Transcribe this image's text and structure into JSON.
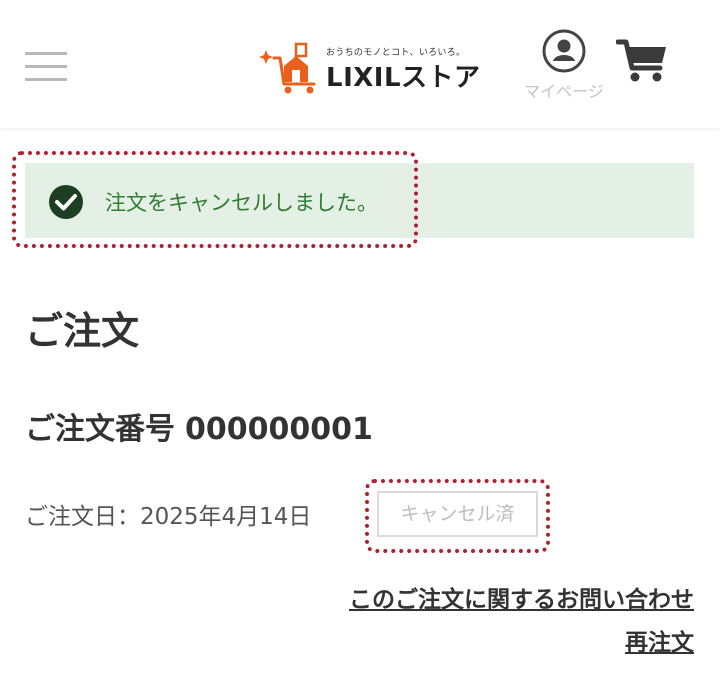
{
  "header": {
    "logo": {
      "tagline": "おうちのモノとコト、いろいろ。",
      "name": "LIXILストア"
    },
    "mypage_label": "マイページ"
  },
  "alert": {
    "message": "注文をキャンセルしました。"
  },
  "order": {
    "page_title": "ご注文",
    "number_label": "ご注文番号",
    "number": "000000001",
    "date_label": "ご注文日：",
    "date": "2025年4月14日",
    "status_badge": "キャンセル済"
  },
  "links": {
    "inquiry": "このご注文に関するお問い合わせ",
    "reorder": "再注文"
  },
  "colors": {
    "success_text": "#2f7d32",
    "success_bg": "#e4efe5",
    "highlight": "#b0202e",
    "brand_orange": "#e8601c"
  }
}
